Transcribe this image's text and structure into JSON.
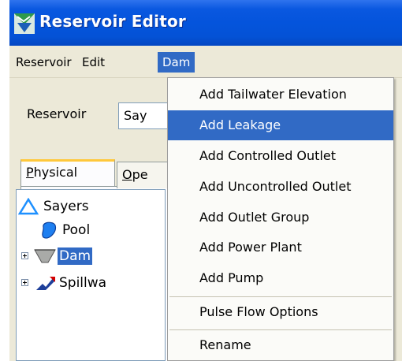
{
  "window": {
    "title": "Reservoir Editor"
  },
  "menubar": {
    "items": [
      "Reservoir",
      "Edit",
      "Dam"
    ],
    "active": "Dam"
  },
  "form": {
    "reservoir_label": "Reservoir",
    "reservoir_value": "Say"
  },
  "tabs": {
    "physical": {
      "mnemonic": "P",
      "rest": "hysical"
    },
    "operations": {
      "mnemonic": "O",
      "rest": "pe"
    }
  },
  "tree": {
    "root": "Sayers",
    "pool": "Pool",
    "dam": "Dam",
    "spillway": "Spillwa"
  },
  "dam_menu": {
    "items": [
      "Add Tailwater Elevation",
      "Add Leakage",
      "Add Controlled Outlet",
      "Add Uncontrolled Outlet",
      "Add Outlet Group",
      "Add Power Plant",
      "Add Pump",
      "Pulse Flow Options",
      "Rename"
    ],
    "highlighted": "Add Leakage"
  },
  "colors": {
    "titlebar": "#0454dc",
    "highlight": "#316ac5",
    "tab_accent": "#ffc83c"
  }
}
